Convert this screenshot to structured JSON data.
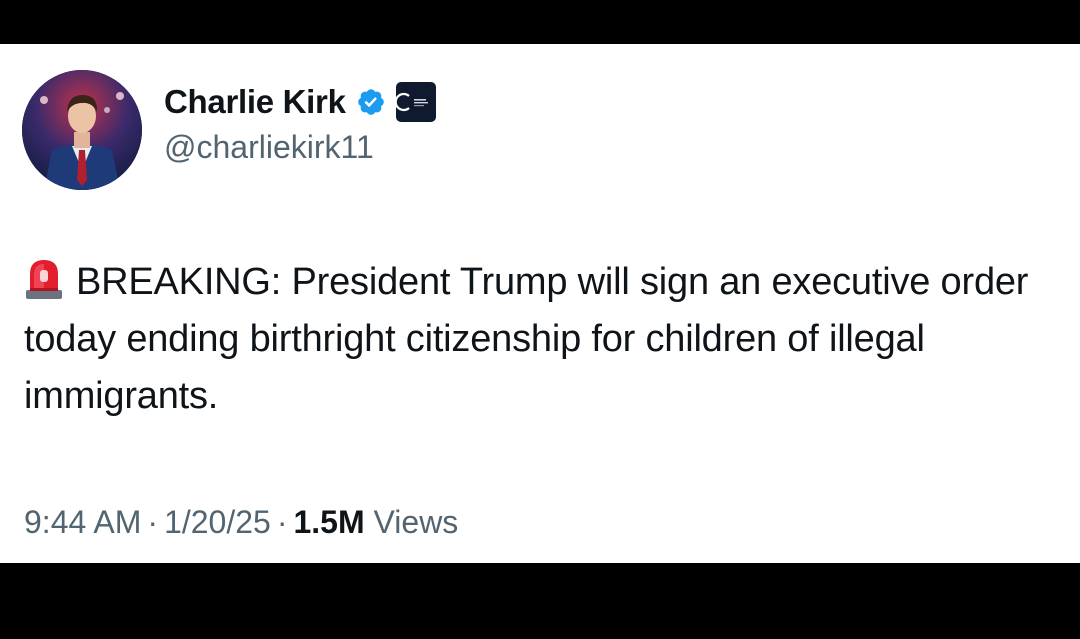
{
  "author": {
    "display_name": "Charlie Kirk",
    "handle": "@charliekirk11",
    "verified": true,
    "verified_color": "#1d9bf0",
    "affiliate_badge": "organization-logo-icon"
  },
  "tweet": {
    "emoji": "police-car-light-icon",
    "text": "BREAKING: President Trump will sign an executive order today ending birthright citizenship for children of illegal immigrants."
  },
  "meta": {
    "time": "9:44 AM",
    "separator": "·",
    "date": "1/20/25",
    "views_count": "1.5M",
    "views_label": "Views"
  },
  "colors": {
    "text_primary": "#0f1419",
    "text_secondary": "#536471",
    "background": "#ffffff",
    "frame": "#000000"
  }
}
